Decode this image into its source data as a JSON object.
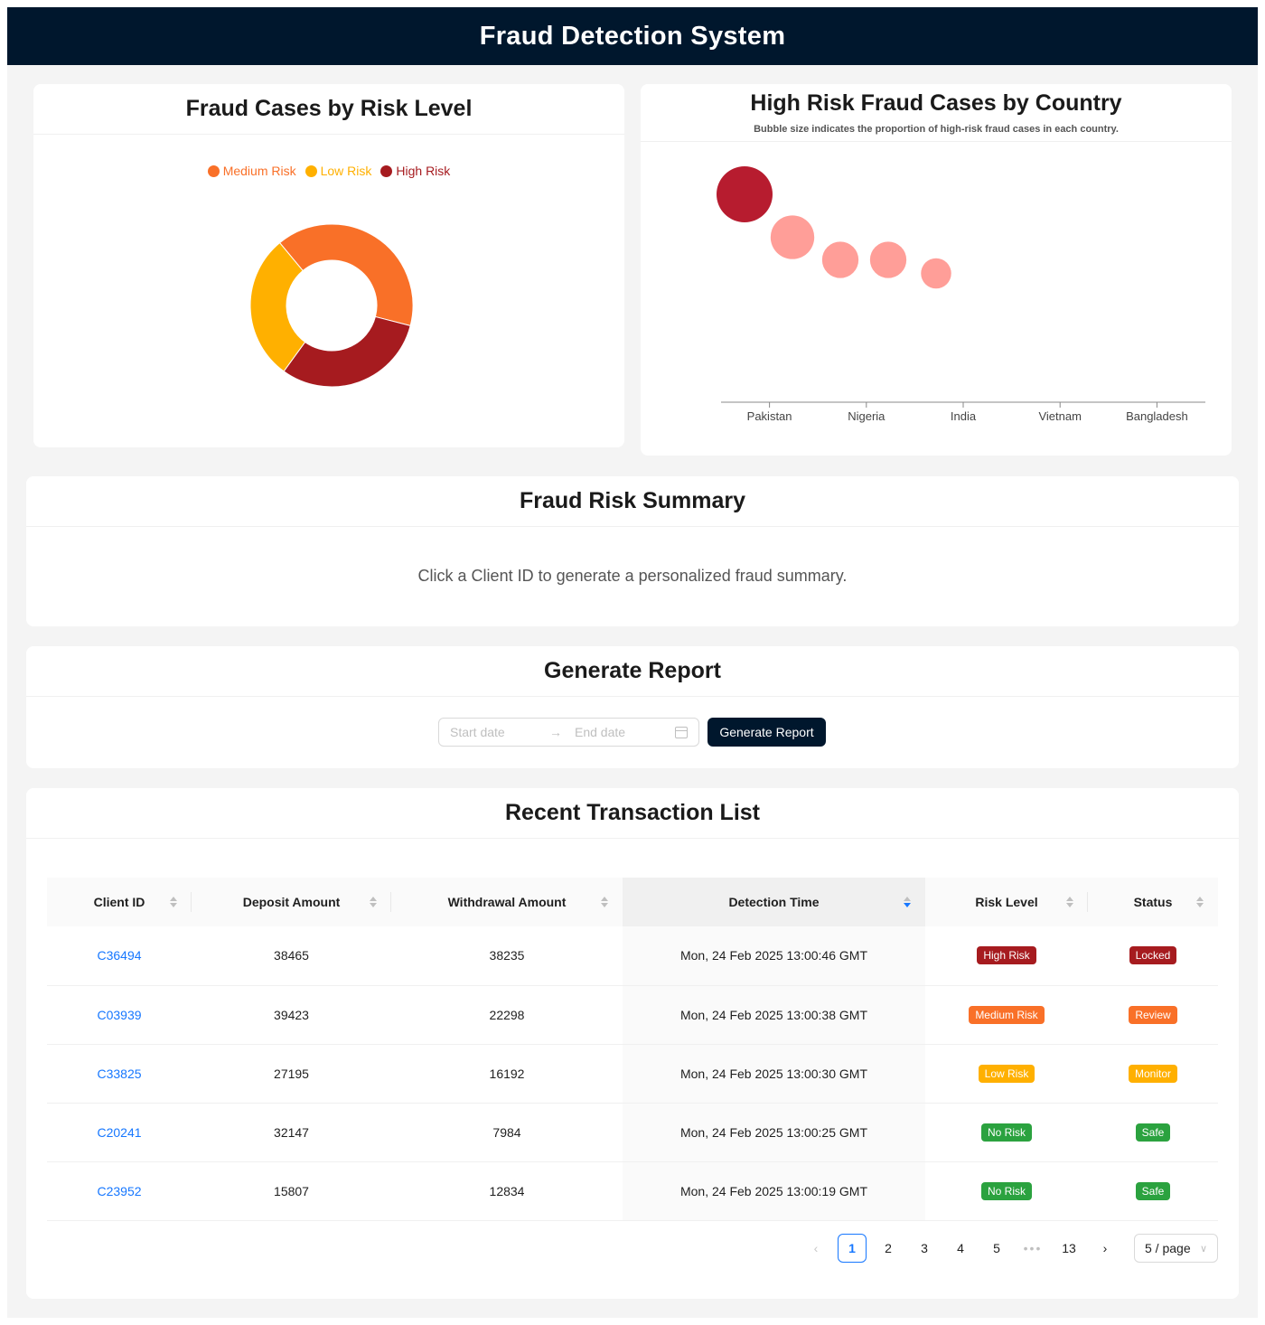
{
  "header": {
    "title": "Fraud Detection System"
  },
  "donut_card": {
    "title": "Fraud Cases by Risk Level",
    "chart_data": {
      "type": "pie",
      "donut": true,
      "legend_position": "top",
      "series": [
        {
          "name": "Medium Risk",
          "value": 40,
          "color": "#f97028"
        },
        {
          "name": "Low Risk",
          "value": 29,
          "color": "#ffb000"
        },
        {
          "name": "High Risk",
          "value": 31,
          "color": "#a61b1f"
        }
      ]
    }
  },
  "bubble_card": {
    "title": "High Risk Fraud Cases by Country",
    "subtitle": "Bubble size indicates the proportion of high-risk fraud cases in each country.",
    "chart_data": {
      "type": "scatter",
      "categories": [
        "Pakistan",
        "Nigeria",
        "India",
        "Vietnam",
        "Bangladesh"
      ],
      "bubbles": [
        {
          "size": 1.0,
          "level": 0.92,
          "color": "#b71c2f"
        },
        {
          "size": 0.78,
          "level": 0.73,
          "color": "#ff9e98"
        },
        {
          "size": 0.65,
          "level": 0.63,
          "color": "#ff9e98"
        },
        {
          "size": 0.65,
          "level": 0.63,
          "color": "#ff9e98"
        },
        {
          "size": 0.54,
          "level": 0.57,
          "color": "#ff9e98"
        }
      ]
    }
  },
  "summary": {
    "title": "Fraud Risk Summary",
    "text": "Click a Client ID to generate a personalized fraud summary."
  },
  "report": {
    "title": "Generate Report",
    "start_placeholder": "Start date",
    "end_placeholder": "End date",
    "button_label": "Generate Report"
  },
  "table": {
    "title": "Recent Transaction List",
    "columns": [
      "Client ID",
      "Deposit Amount",
      "Withdrawal Amount",
      "Detection Time",
      "Risk Level",
      "Status"
    ],
    "rows": [
      {
        "client_id": "C36494",
        "deposit": "38465",
        "withdrawal": "38235",
        "time": "Mon, 24 Feb 2025 13:00:46 GMT",
        "risk": "High Risk",
        "risk_color": "#a61b1f",
        "status": "Locked",
        "status_color": "#a61b1f"
      },
      {
        "client_id": "C03939",
        "deposit": "39423",
        "withdrawal": "22298",
        "time": "Mon, 24 Feb 2025 13:00:38 GMT",
        "risk": "Medium Risk",
        "risk_color": "#f97028",
        "status": "Review",
        "status_color": "#f97028"
      },
      {
        "client_id": "C33825",
        "deposit": "27195",
        "withdrawal": "16192",
        "time": "Mon, 24 Feb 2025 13:00:30 GMT",
        "risk": "Low Risk",
        "risk_color": "#ffb000",
        "status": "Monitor",
        "status_color": "#ffb000"
      },
      {
        "client_id": "C20241",
        "deposit": "32147",
        "withdrawal": "7984",
        "time": "Mon, 24 Feb 2025 13:00:25 GMT",
        "risk": "No Risk",
        "risk_color": "#2ba23f",
        "status": "Safe",
        "status_color": "#2ba23f"
      },
      {
        "client_id": "C23952",
        "deposit": "15807",
        "withdrawal": "12834",
        "time": "Mon, 24 Feb 2025 13:00:19 GMT",
        "risk": "No Risk",
        "risk_color": "#2ba23f",
        "status": "Safe",
        "status_color": "#2ba23f"
      }
    ],
    "pagination": {
      "pages": [
        "1",
        "2",
        "3",
        "4",
        "5"
      ],
      "ellipsis": "•••",
      "last_page": "13",
      "current": "1",
      "page_size": "5 / page"
    }
  }
}
